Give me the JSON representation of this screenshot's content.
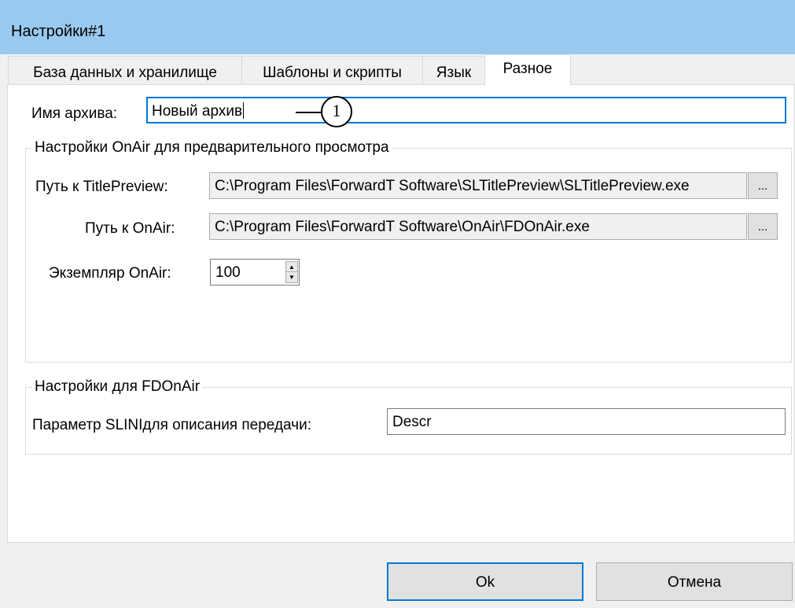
{
  "window": {
    "title": "Настройки#1"
  },
  "tabs": [
    {
      "label": "База данных и хранилище"
    },
    {
      "label": "Шаблоны и скрипты"
    },
    {
      "label": "Язык"
    },
    {
      "label": "Разное"
    }
  ],
  "archive": {
    "label": "Имя архива:",
    "value": "Новый архив"
  },
  "callout": {
    "number": "1"
  },
  "onair_preview": {
    "title": "Настройки OnAir для предварительного просмотра",
    "titlepreview_label": "Путь к TitlePreview:",
    "titlepreview_value": "C:\\Program Files\\ForwardT Software\\SLTitlePreview\\SLTitlePreview.exe",
    "onair_label": "Путь к OnAir:",
    "onair_value": "C:\\Program Files\\ForwardT Software\\OnAir\\FDOnAir.exe",
    "browse_label": "...",
    "instance_label": "Экземпляр OnAir:",
    "instance_value": "100"
  },
  "fdonair": {
    "title": "Настройки для FDOnAir",
    "param_label": "Параметр SLINIдля описания передачи:",
    "param_value": "Descr"
  },
  "buttons": {
    "ok": "Ok",
    "cancel": "Отмена"
  }
}
